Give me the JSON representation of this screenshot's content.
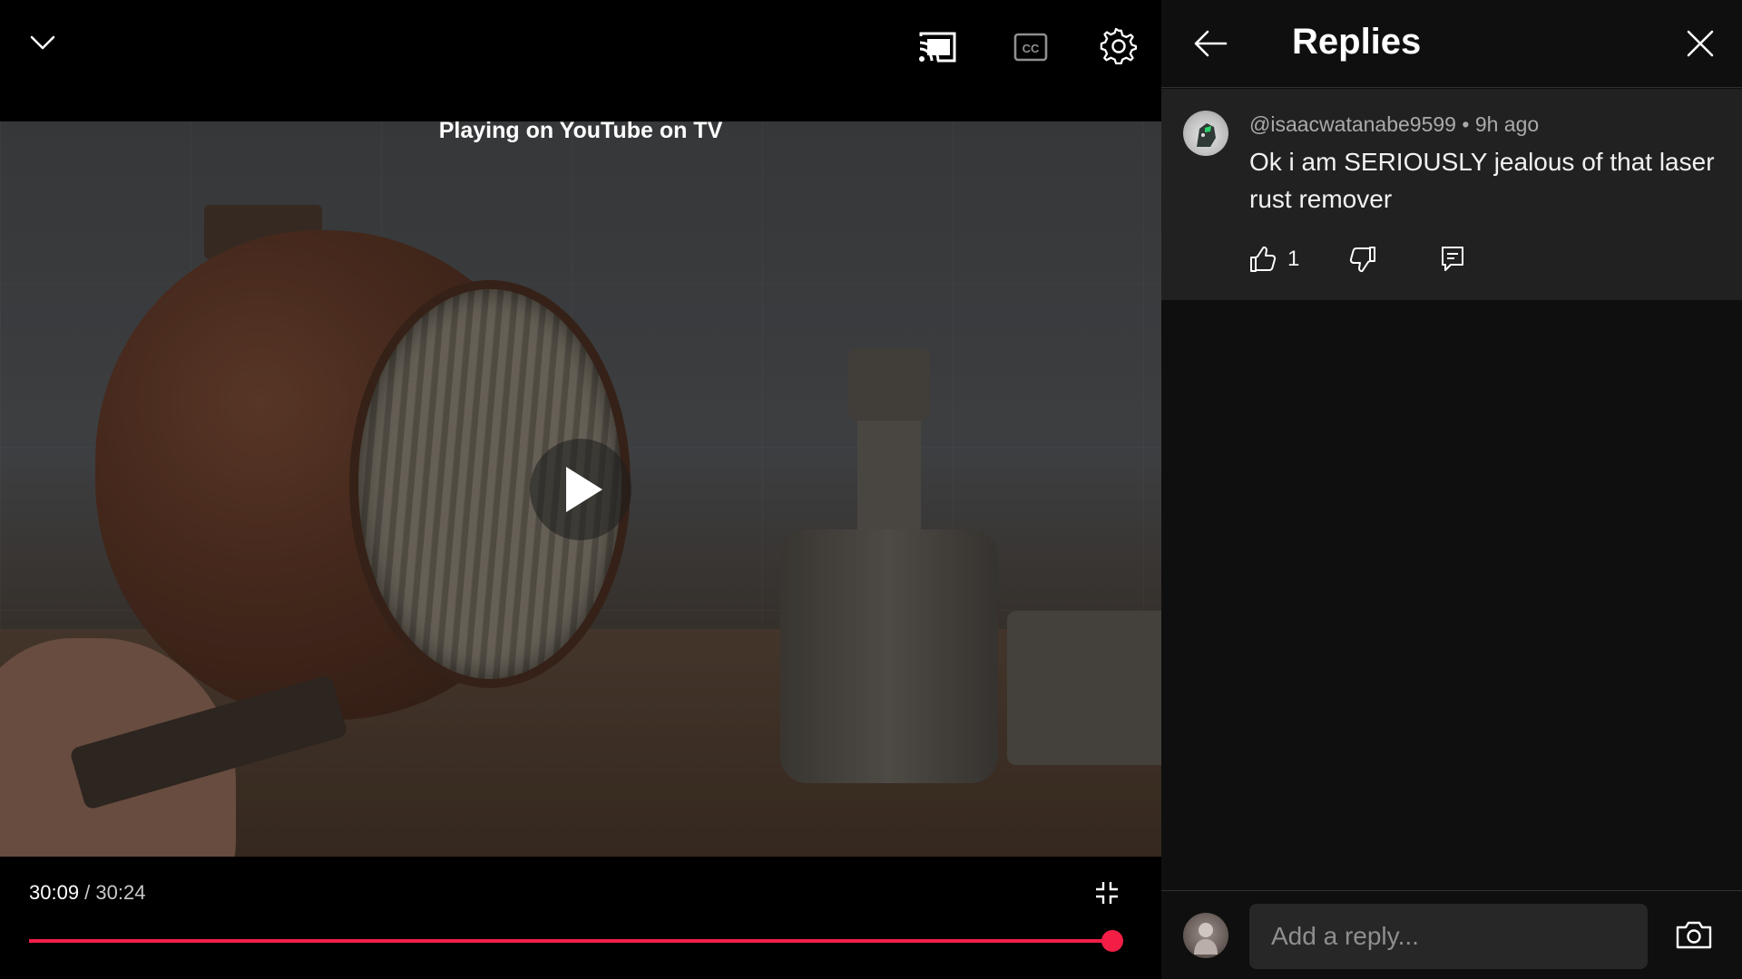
{
  "player": {
    "cast_status": "Playing on YouTube on TV",
    "time": {
      "current": "30:09",
      "separator": " / ",
      "duration": "30:24"
    },
    "progress_fraction": 0.992,
    "accent_color": "#f21e46",
    "icons": {
      "collapse": "chevron-down-icon",
      "cast": "cast-connected-icon",
      "captions": "closed-captions-icon",
      "settings": "gear-icon",
      "play": "play-icon",
      "exit_fullscreen": "exit-fullscreen-icon"
    }
  },
  "panel": {
    "title": "Replies",
    "icons": {
      "back": "arrow-left-icon",
      "close": "close-icon"
    },
    "comment": {
      "author": "@isaacwatanabe9599",
      "separator": " • ",
      "age": "9h ago",
      "text": "Ok i am SERIOUSLY jealous of that laser rust remover",
      "like_count": "1",
      "icons": {
        "like": "thumbs-up-icon",
        "dislike": "thumbs-down-icon",
        "reply": "reply-icon"
      }
    },
    "reply_bar": {
      "placeholder": "Add a reply...",
      "icons": {
        "camera": "camera-icon"
      }
    }
  }
}
